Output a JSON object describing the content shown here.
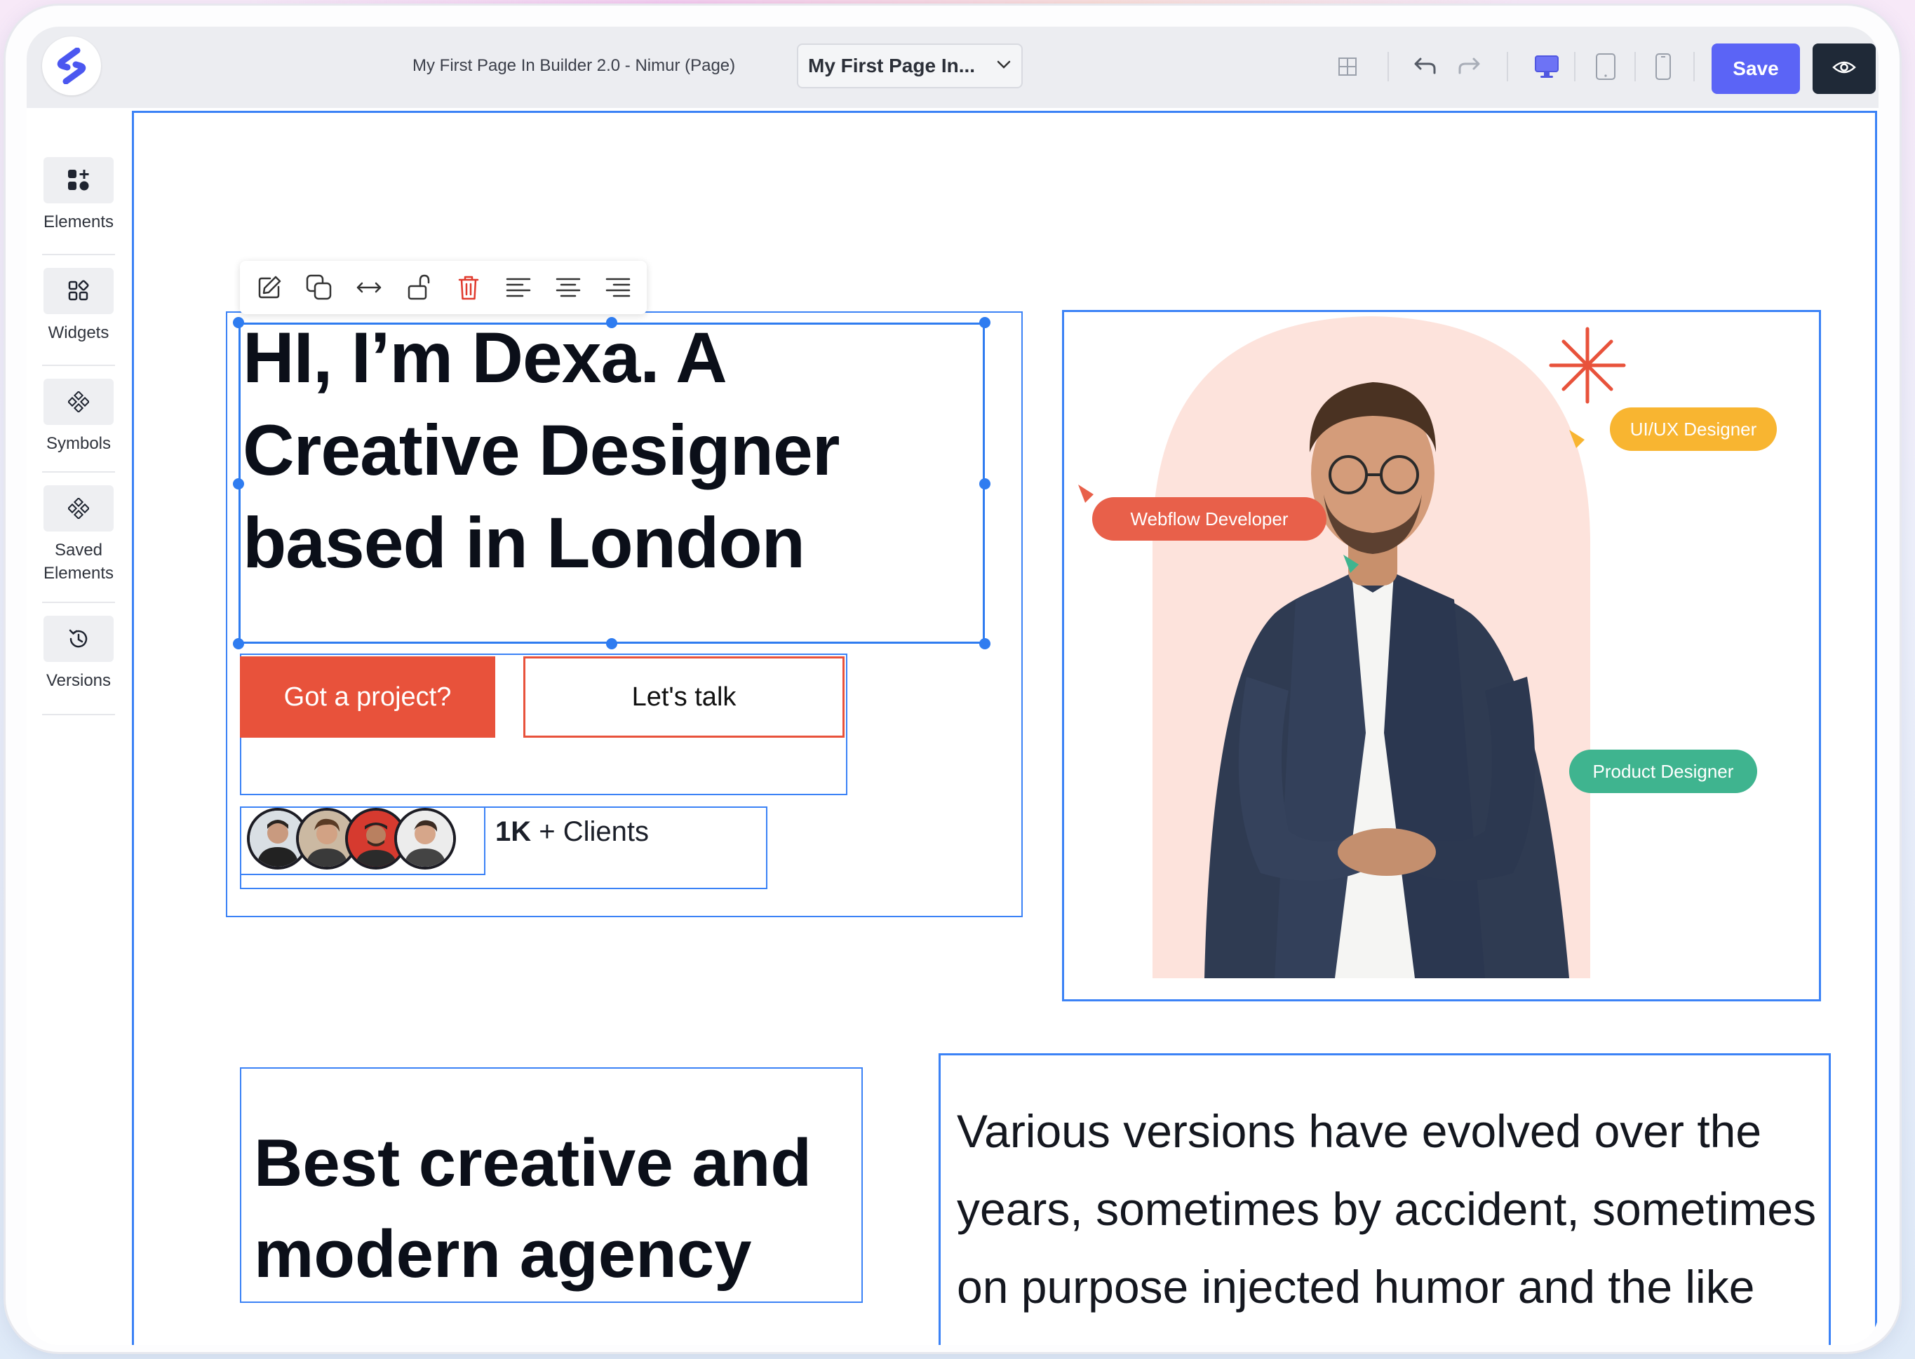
{
  "app": {
    "logo": "logo-icon"
  },
  "topbar": {
    "document_title": "My First Page In Builder 2.0 - Nimur (Page)",
    "page_select_value": "My First Page In...",
    "save_label": "Save",
    "icons": [
      "grid-icon",
      "undo-icon",
      "redo-icon",
      "desktop-icon",
      "tablet-icon",
      "mobile-icon",
      "eye-icon"
    ]
  },
  "sidebar": {
    "items": [
      {
        "label": "Elements",
        "icon": "elements-icon"
      },
      {
        "label": "Widgets",
        "icon": "widgets-icon"
      },
      {
        "label": "Symbols",
        "icon": "symbols-icon"
      },
      {
        "label": "Saved\nElements",
        "icon": "saved-elements-icon"
      },
      {
        "label": "Versions",
        "icon": "history-icon"
      }
    ]
  },
  "toolbar": {
    "icons": [
      "edit-icon",
      "duplicate-icon",
      "resize-horizontal-icon",
      "unlock-icon",
      "delete-icon",
      "align-left-icon",
      "align-center-icon",
      "align-right-icon"
    ]
  },
  "hero": {
    "title": "HI, I’m Dexa. A Creative Designer based in London",
    "primary_button": "Got a project?",
    "secondary_button": "Let's talk",
    "clients_count": "1K",
    "clients_label": "+ Clients",
    "tags": {
      "webflow": "Webflow Developer",
      "uiux": "UI/UX Designer",
      "product": "Product Designer"
    }
  },
  "section2": {
    "heading": "Best creative and modern agency",
    "paragraph": "Various versions have evolved over the years, sometimes by accident, sometimes on purpose injected humor and the like"
  },
  "colors": {
    "accent": "#5b64f6",
    "selection": "#3b82f6",
    "cta": "#e8523b",
    "tag_webflow": "#e8604a",
    "tag_uiux": "#f8b531",
    "tag_product": "#3fb48f"
  }
}
